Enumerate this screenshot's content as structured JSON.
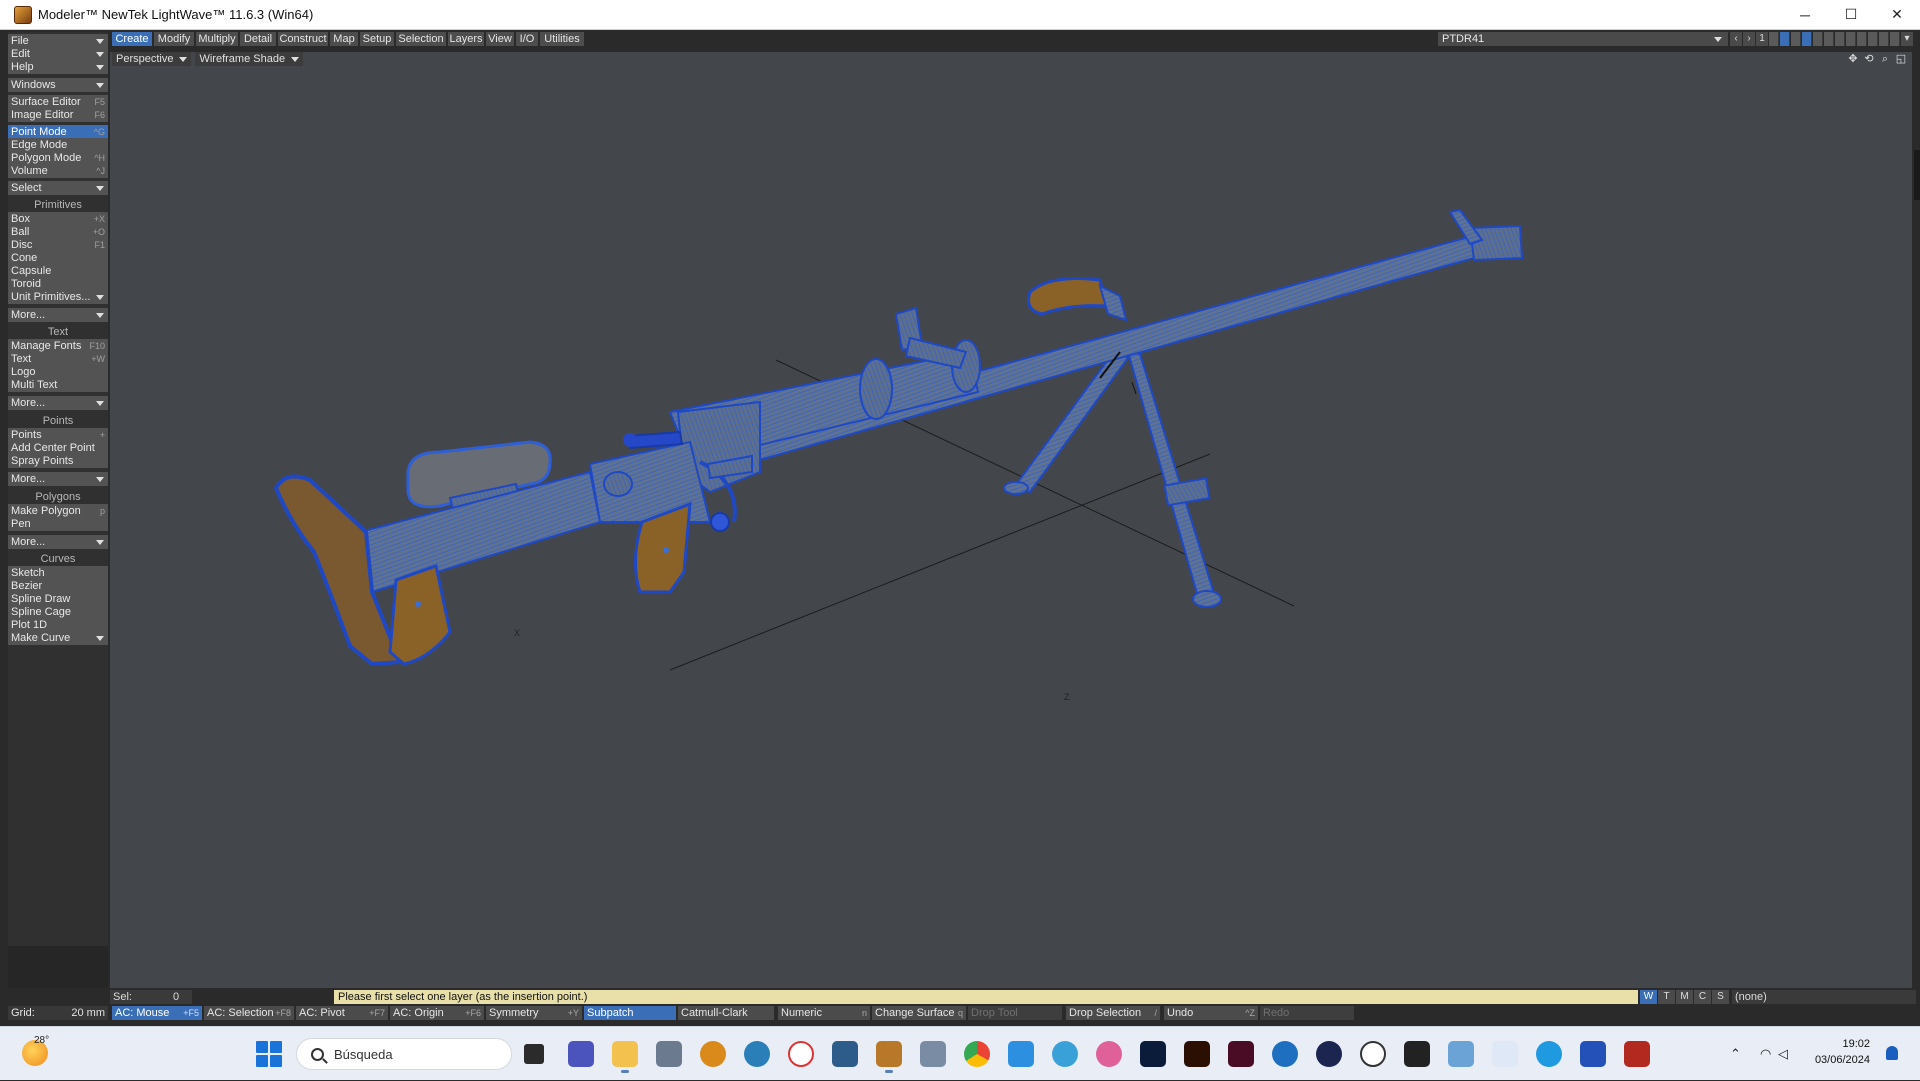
{
  "window": {
    "title": "Modeler™ NewTek LightWave™ 11.6.3 (Win64)",
    "minimize": "─",
    "maximize": "☐",
    "close": "✕"
  },
  "left_panel": {
    "file": "File",
    "edit": "Edit",
    "help": "Help",
    "windows": "Windows",
    "surface_editor": "Surface Editor",
    "surface_editor_sc": "F5",
    "image_editor": "Image Editor",
    "image_editor_sc": "F6",
    "point_mode": "Point Mode",
    "point_mode_sc": "^G",
    "edge_mode": "Edge Mode",
    "polygon_mode": "Polygon Mode",
    "polygon_mode_sc": "^H",
    "volume": "Volume",
    "volume_sc": "^J",
    "select": "Select",
    "primitives_header": "Primitives",
    "box": "Box",
    "box_sc": "+X",
    "ball": "Ball",
    "ball_sc": "+O",
    "disc": "Disc",
    "disc_sc": "F1",
    "cone": "Cone",
    "capsule": "Capsule",
    "toroid": "Toroid",
    "unit_primitives": "Unit Primitives...",
    "more1": "More...",
    "text_header": "Text",
    "manage_fonts": "Manage Fonts",
    "manage_fonts_sc": "F10",
    "text": "Text",
    "text_sc": "+W",
    "logo": "Logo",
    "multi_text": "Multi Text",
    "more2": "More...",
    "points_header": "Points",
    "points": "Points",
    "points_sc": "+",
    "add_center_point": "Add Center Point",
    "spray_points": "Spray Points",
    "more3": "More...",
    "polygons_header": "Polygons",
    "make_polygon": "Make Polygon",
    "make_polygon_sc": "p",
    "pen": "Pen",
    "more4": "More...",
    "curves_header": "Curves",
    "sketch": "Sketch",
    "bezier": "Bezier",
    "spline_draw": "Spline Draw",
    "spline_cage": "Spline Cage",
    "plot_1d": "Plot 1D",
    "make_curve": "Make Curve"
  },
  "tabs": [
    "Create",
    "Modify",
    "Multiply",
    "Detail",
    "Construct",
    "Map",
    "Setup",
    "Selection",
    "Layers",
    "View",
    "I/O",
    "Utilities"
  ],
  "top_right": {
    "object_name": "PTDR41",
    "layer_number": "1"
  },
  "viewport": {
    "view_type": "Perspective",
    "render_mode": "Wireframe Shade",
    "axis_x": "X",
    "axis_z": "Z"
  },
  "status": {
    "sel_label": "Sel:",
    "sel_value": "0",
    "message": "Please first select one layer  (as the insertion point.)",
    "wtmcs": [
      "W",
      "T",
      "M",
      "C",
      "S"
    ],
    "surface": "(none)"
  },
  "toolbar": {
    "grid_label": "Grid:",
    "grid_value": "20 mm",
    "ac_mouse": "AC: Mouse",
    "ac_mouse_sc": "+F5",
    "ac_selection": "AC: Selection",
    "ac_selection_sc": "+F8",
    "ac_pivot": "AC: Pivot",
    "ac_pivot_sc": "+F7",
    "ac_origin": "AC: Origin",
    "ac_origin_sc": "+F6",
    "symmetry": "Symmetry",
    "symmetry_sc": "+Y",
    "subpatch": "Subpatch",
    "catmull_clark": "Catmull-Clark",
    "numeric": "Numeric",
    "numeric_sc": "n",
    "change_surface": "Change Surface",
    "change_surface_sc": "q",
    "drop_tool": "Drop Tool",
    "drop_selection": "Drop Selection",
    "drop_selection_sc": "/",
    "undo": "Undo",
    "undo_sc": "^Z",
    "redo": "Redo"
  },
  "taskbar": {
    "temperature": "28°",
    "search_placeholder": "Búsqueda",
    "time": "19:02",
    "date": "03/06/2024"
  },
  "colors": {
    "accent": "#3a6fb8",
    "wire": "#2e5fd6",
    "wood": "#8a6228",
    "message_bg": "#e8e0a8"
  }
}
